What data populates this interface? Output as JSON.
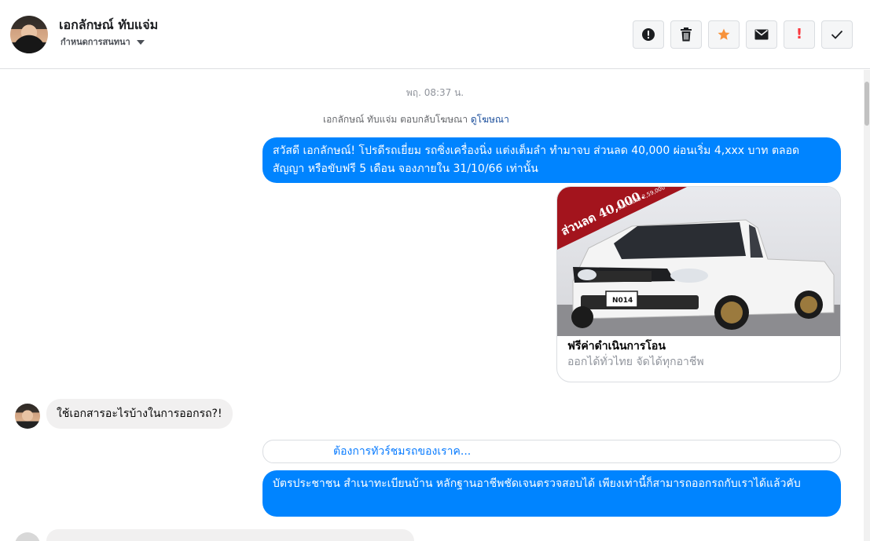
{
  "header": {
    "contact_name": "เอกลักษณ์ ทับแจ่ม",
    "conversation_settings_label": "กำหนดการสนทนา",
    "actions": [
      {
        "name": "info",
        "icon": "alert-circle-icon",
        "color": "#1c1e21"
      },
      {
        "name": "delete",
        "icon": "trash-icon",
        "color": "#1c1e21"
      },
      {
        "name": "star",
        "icon": "star-icon",
        "color": "#f7923b"
      },
      {
        "name": "mail",
        "icon": "envelope-icon",
        "color": "#1c1e21"
      },
      {
        "name": "spam",
        "icon": "exclamation-icon",
        "color": "#fa383e",
        "label": "!"
      },
      {
        "name": "done",
        "icon": "check-icon",
        "color": "#1c1e21"
      }
    ]
  },
  "chat": {
    "timestamp": "พฤ. 08:37 น.",
    "reply_note": {
      "text": "เอกลักษณ์ ทับแจ่ม ตอบกลับโฆษณา ",
      "link": "ดูโฆษณา"
    },
    "messages": [
      {
        "sender": "page",
        "text": "สวัสดี เอกลักษณ์! โปรดีรถเยี่ยม รถซิ่งเครื่องนิ่ง แต่งเต็มลำ ทำมาจบ ส่วนลด 40,000 ผ่อนเริ่ม 4,xxx บาท ตลอดสัญญา หรือขับฟรี 5 เดือน จองภายใน 31/10/66 เท่านั้น"
      },
      {
        "sender": "page",
        "type": "ad_card",
        "image_label": "ส่วนลด 40,000.",
        "image_sub_label": "ราคาพิเศษ 2,59,000",
        "plate": "N014",
        "title": "ฟรีค่าดำเนินการโอน",
        "subtitle": "ออกได้ทั่วไทย จัดได้ทุกอาชีพ"
      },
      {
        "sender": "user",
        "text": "ใช้เอกสารอะไรบ้างในการออกรถ?!"
      },
      {
        "sender": "page",
        "type": "quick_reply",
        "text": "ต้องการทัวร์ชมรถของเราค..."
      },
      {
        "sender": "page",
        "text": "บัตรประชาชน สำเนาทะเบียนบ้าน หลักฐานอาชีพชัดเจนตรวจสอบได้ เพียงเท่านี้ก็สามารถออกรถกับเราได้แล้วคับ"
      }
    ]
  },
  "colors": {
    "outgoing_bubble": "#0084ff",
    "incoming_bubble": "#f1f0f0",
    "link": "#0a7cff"
  }
}
